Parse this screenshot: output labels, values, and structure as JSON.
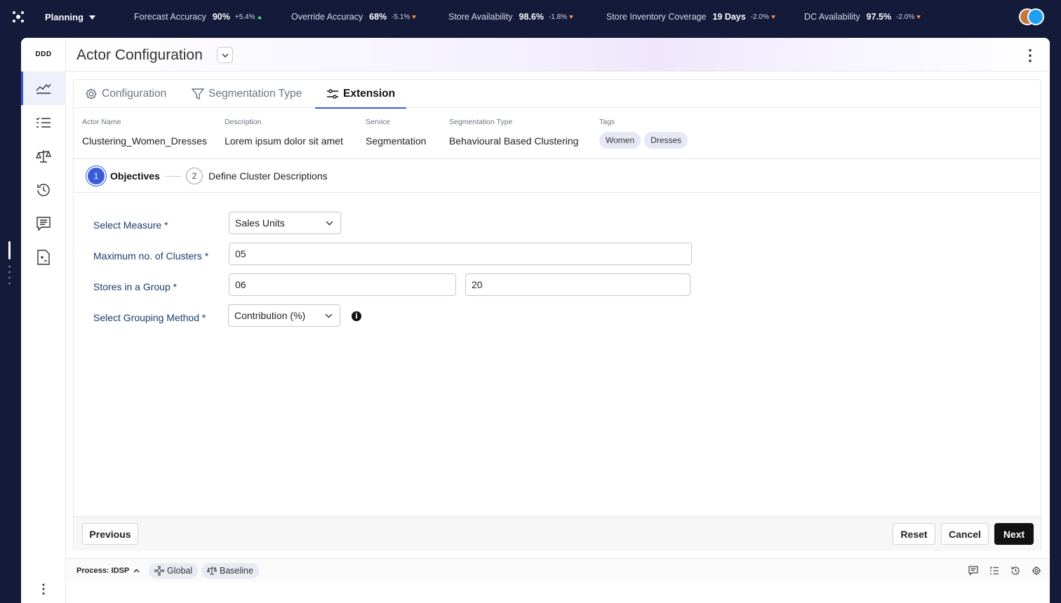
{
  "topbar": {
    "menu_label": "Planning",
    "kpis": [
      {
        "label": "Forecast Accuracy",
        "value": "90%",
        "delta": "+5.4%",
        "trend": "up"
      },
      {
        "label": "Override Accuracy",
        "value": "68%",
        "delta": "-5.1%",
        "trend": "down"
      },
      {
        "label": "Store Availability",
        "value": "98.6%",
        "delta": "-1.8%",
        "trend": "down"
      },
      {
        "label": "Store Inventory Coverage",
        "value": "19 Days",
        "delta": "-2.0%",
        "trend": "down"
      },
      {
        "label": "DC Availability",
        "value": "97.5%",
        "delta": "-2.0%",
        "trend": "down"
      }
    ]
  },
  "leftnav": {
    "workspace": "DDD",
    "items": [
      "chart-icon",
      "checklist-icon",
      "balance-scale-icon",
      "history-icon",
      "comments-icon",
      "calculator-icon"
    ]
  },
  "header": {
    "title": "Actor Configuration"
  },
  "tabs": [
    {
      "label": "Configuration",
      "icon": "gear-icon"
    },
    {
      "label": "Segmentation Type",
      "icon": "filter-icon"
    },
    {
      "label": "Extension",
      "icon": "sliders-icon",
      "active": true
    }
  ],
  "info": {
    "actor_name_label": "Actor Name",
    "actor_name": "Clustering_Women_Dresses",
    "description_label": "Description",
    "description": "Lorem ipsum dolor sit amet",
    "service_label": "Service",
    "service": "Segmentation",
    "seg_type_label": "Segmentation Type",
    "seg_type": "Behavioural Based Clustering",
    "tags_label": "Tags",
    "tags": [
      "Women",
      "Dresses"
    ]
  },
  "stepper": {
    "steps": [
      {
        "num": "1",
        "label": "Objectives",
        "active": true
      },
      {
        "num": "2",
        "label": "Define Cluster Descriptions",
        "active": false
      }
    ]
  },
  "form": {
    "measure_label": "Select Measure *",
    "measure_value": "Sales Units",
    "clusters_label": "Maximum no. of Clusters *",
    "clusters_value": "05",
    "stores_label": "Stores in a Group *",
    "stores_min": "06",
    "stores_max": "20",
    "grouping_label": "Select Grouping Method *",
    "grouping_value": "Contribution (%)"
  },
  "footer": {
    "previous": "Previous",
    "reset": "Reset",
    "cancel": "Cancel",
    "next": "Next"
  },
  "statusbar": {
    "process": "Process: IDSP",
    "global": "Global",
    "baseline": "Baseline"
  },
  "colors": {
    "accent": "#3b5bdb",
    "topbar": "#141a3a",
    "up": "#4ade80",
    "down": "#fb923c"
  }
}
